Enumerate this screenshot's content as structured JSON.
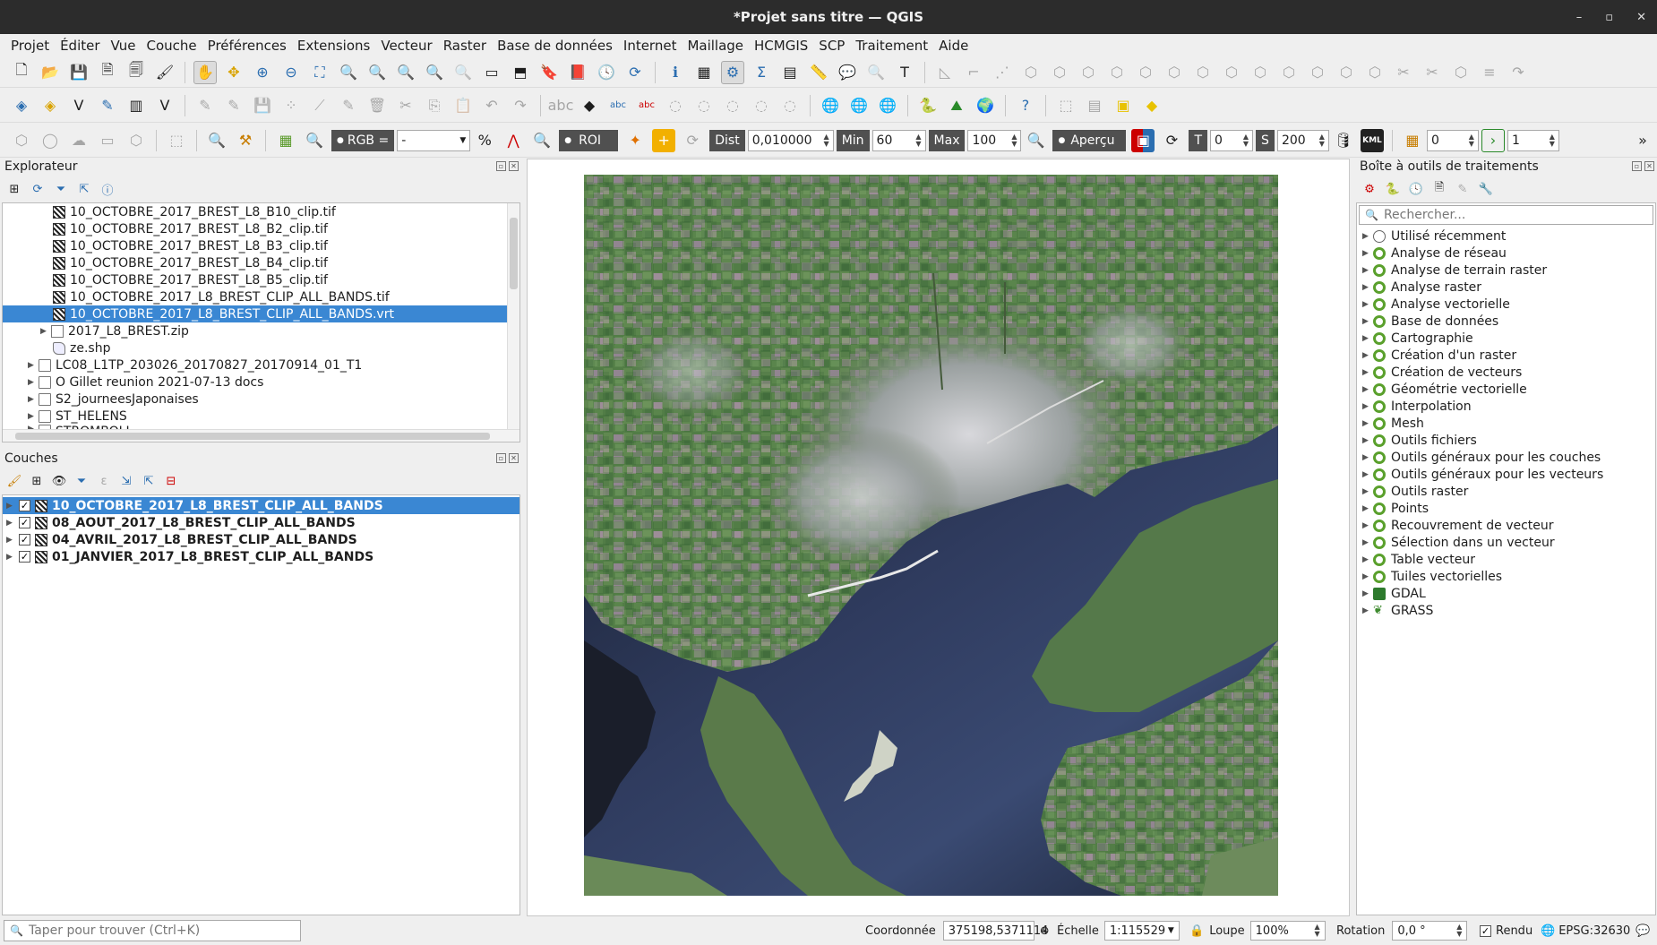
{
  "window": {
    "title": "*Projet sans titre — QGIS",
    "controls": [
      "–",
      "▫",
      "✕"
    ]
  },
  "menu": [
    "Projet",
    "Éditer",
    "Vue",
    "Couche",
    "Préférences",
    "Extensions",
    "Vecteur",
    "Raster",
    "Base de données",
    "Internet",
    "Maillage",
    "HCMGIS",
    "SCP",
    "Traitement",
    "Aide"
  ],
  "scp_toolbar": {
    "rgb_label": "RGB =",
    "rgb_value": "-",
    "roi_label": "ROI",
    "dist_label": "Dist",
    "dist_value": "0,010000",
    "min_label": "Min",
    "min_value": "60",
    "max_label": "Max",
    "max_value": "100",
    "preview_label": "Aperçu",
    "t_label": "T",
    "t_value": "0",
    "s_label": "S",
    "s_value": "200",
    "kml_label": "KML",
    "band_value": "0",
    "step_value": "1"
  },
  "browser": {
    "title": "Explorateur",
    "items": [
      {
        "label": "10_OCTOBRE_2017_BREST_L8_B10_clip.tif",
        "icon": "raster"
      },
      {
        "label": "10_OCTOBRE_2017_BREST_L8_B2_clip.tif",
        "icon": "raster"
      },
      {
        "label": "10_OCTOBRE_2017_BREST_L8_B3_clip.tif",
        "icon": "raster"
      },
      {
        "label": "10_OCTOBRE_2017_BREST_L8_B4_clip.tif",
        "icon": "raster"
      },
      {
        "label": "10_OCTOBRE_2017_BREST_L8_B5_clip.tif",
        "icon": "raster"
      },
      {
        "label": "10_OCTOBRE_2017_L8_BREST_CLIP_ALL_BANDS.tif",
        "icon": "raster"
      },
      {
        "label": "10_OCTOBRE_2017_L8_BREST_CLIP_ALL_BANDS.vrt",
        "icon": "raster"
      },
      {
        "label": "2017_L8_BREST.zip",
        "icon": "zip"
      },
      {
        "label": "ze.shp",
        "icon": "vector"
      },
      {
        "label": "LC08_L1TP_203026_20170827_20170914_01_T1",
        "icon": "folder"
      },
      {
        "label": "O Gillet reunion 2021-07-13 docs",
        "icon": "folder"
      },
      {
        "label": "S2_journeesJaponaises",
        "icon": "folder"
      },
      {
        "label": "ST_HELENS",
        "icon": "folder"
      },
      {
        "label": "STROMBOLI",
        "icon": "folder"
      }
    ]
  },
  "layers": {
    "title": "Couches",
    "items": [
      {
        "label": "10_OCTOBRE_2017_L8_BREST_CLIP_ALL_BANDS",
        "checked": "✓"
      },
      {
        "label": "08_AOUT_2017_L8_BREST_CLIP_ALL_BANDS",
        "checked": "✓"
      },
      {
        "label": "04_AVRIL_2017_L8_BREST_CLIP_ALL_BANDS",
        "checked": "✓"
      },
      {
        "label": "01_JANVIER_2017_L8_BREST_CLIP_ALL_BANDS",
        "checked": "✓"
      }
    ]
  },
  "toolbox": {
    "title": "Boîte à outils de traitements",
    "search_placeholder": "Rechercher...",
    "items": [
      {
        "label": "Utilisé récemment",
        "icon": "clock"
      },
      {
        "label": "Analyse de réseau",
        "icon": "qgis"
      },
      {
        "label": "Analyse de terrain raster",
        "icon": "qgis"
      },
      {
        "label": "Analyse raster",
        "icon": "qgis"
      },
      {
        "label": "Analyse vectorielle",
        "icon": "qgis"
      },
      {
        "label": "Base de données",
        "icon": "qgis"
      },
      {
        "label": "Cartographie",
        "icon": "qgis"
      },
      {
        "label": "Création d'un raster",
        "icon": "qgis"
      },
      {
        "label": "Création de vecteurs",
        "icon": "qgis"
      },
      {
        "label": "Géométrie vectorielle",
        "icon": "qgis"
      },
      {
        "label": "Interpolation",
        "icon": "qgis"
      },
      {
        "label": "Mesh",
        "icon": "qgis"
      },
      {
        "label": "Outils fichiers",
        "icon": "qgis"
      },
      {
        "label": "Outils généraux pour les couches",
        "icon": "qgis"
      },
      {
        "label": "Outils généraux pour les vecteurs",
        "icon": "qgis"
      },
      {
        "label": "Outils raster",
        "icon": "qgis"
      },
      {
        "label": "Points",
        "icon": "qgis"
      },
      {
        "label": "Recouvrement de vecteur",
        "icon": "qgis"
      },
      {
        "label": "Sélection dans un vecteur",
        "icon": "qgis"
      },
      {
        "label": "Table vecteur",
        "icon": "qgis"
      },
      {
        "label": "Tuiles vectorielles",
        "icon": "qgis"
      },
      {
        "label": "GDAL",
        "icon": "gdal"
      },
      {
        "label": "GRASS",
        "icon": "grass"
      }
    ]
  },
  "status": {
    "locator_placeholder": "Taper pour trouver (Ctrl+K)",
    "coord_label": "Coordonnée",
    "coord_value": "375198,5371114",
    "scale_label": "Échelle",
    "scale_value": "1:115529",
    "magnifier_label": "Loupe",
    "magnifier_value": "100%",
    "rotation_label": "Rotation",
    "rotation_value": "0,0 °",
    "render_label": "Rendu",
    "render_checked": "✓",
    "crs": "EPSG:32630"
  },
  "colors": {
    "selection": "#3a87d3",
    "titlebar": "#2c2c2c",
    "qgis_green": "#5aa02c"
  }
}
